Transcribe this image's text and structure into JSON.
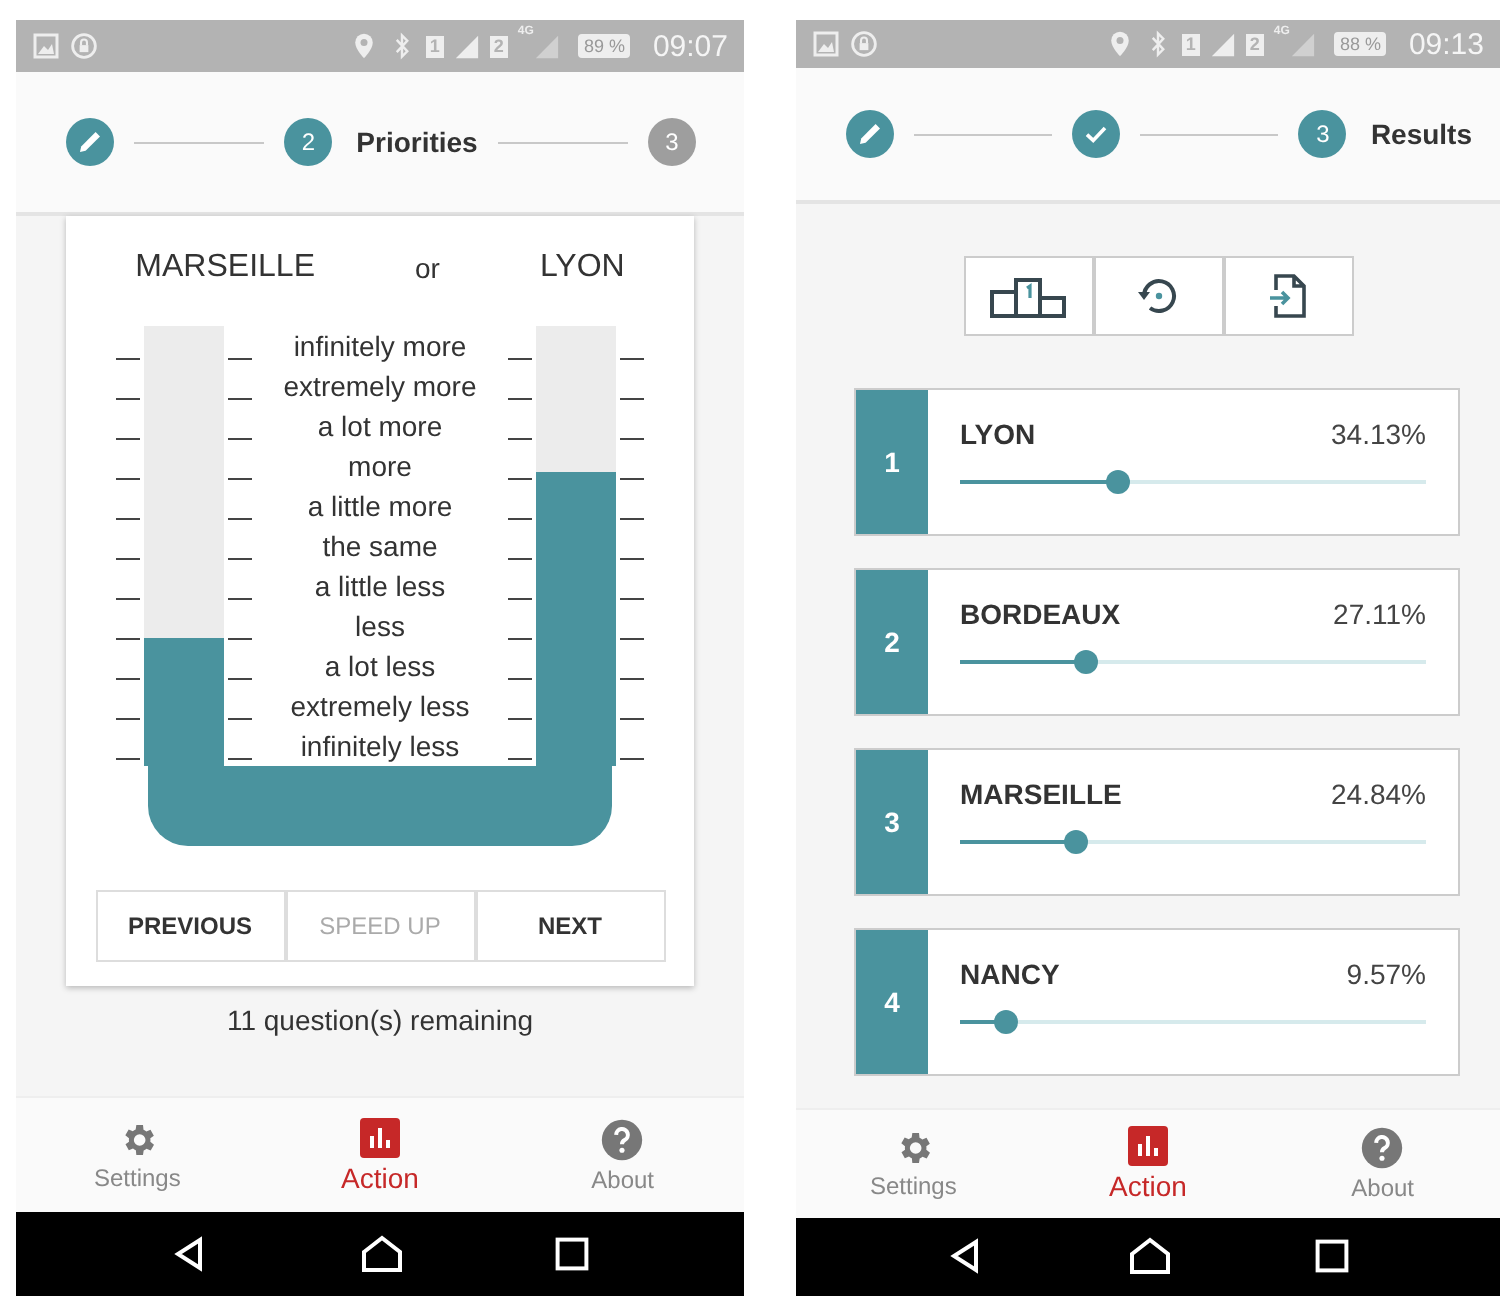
{
  "screens": [
    {
      "status_bar": {
        "sims": [
          "1",
          "2"
        ],
        "network": "4G",
        "battery": "89 %",
        "time": "09:07"
      },
      "steps": [
        {
          "kind": "edit",
          "active": true
        },
        {
          "kind": "number",
          "number": "2",
          "label": "Priorities",
          "active": true
        },
        {
          "kind": "number",
          "number": "3",
          "active": false
        }
      ],
      "comparison": {
        "left": {
          "name": "MARSEILLE",
          "level": 0.29
        },
        "connector": "or",
        "right": {
          "name": "LYON",
          "level": 0.67
        },
        "scale": [
          "infinitely more",
          "extremely more",
          "a lot more",
          "more",
          "a little more",
          "the same",
          "a little less",
          "less",
          "a lot less",
          "extremely less",
          "infinitely less"
        ]
      },
      "buttons": [
        {
          "label": "PREVIOUS",
          "disabled": false
        },
        {
          "label": "SPEED UP",
          "disabled": true
        },
        {
          "label": "NEXT",
          "disabled": false
        }
      ],
      "remaining": "11 question(s) remaining",
      "nav": [
        {
          "label": "Settings",
          "selected": false
        },
        {
          "label": "Action",
          "selected": true
        },
        {
          "label": "About",
          "selected": false
        }
      ]
    },
    {
      "status_bar": {
        "sims": [
          "1",
          "2"
        ],
        "network": "4G",
        "battery": "88 %",
        "time": "09:13"
      },
      "steps": [
        {
          "kind": "edit",
          "active": true
        },
        {
          "kind": "done",
          "active": true
        },
        {
          "kind": "number",
          "number": "3",
          "label": "Results",
          "active": true
        }
      ],
      "results": [
        {
          "rank": "1",
          "name": "LYON",
          "share": "34.13%",
          "level": 0.34
        },
        {
          "rank": "2",
          "name": "BORDEAUX",
          "share": "27.11%",
          "level": 0.27
        },
        {
          "rank": "3",
          "name": "MARSEILLE",
          "share": "24.84%",
          "level": 0.25
        },
        {
          "rank": "4",
          "name": "NANCY",
          "share": "9.57%",
          "level": 0.1
        }
      ],
      "nav": [
        {
          "label": "Settings",
          "selected": false
        },
        {
          "label": "Action",
          "selected": true
        },
        {
          "label": "About",
          "selected": false
        }
      ]
    }
  ]
}
